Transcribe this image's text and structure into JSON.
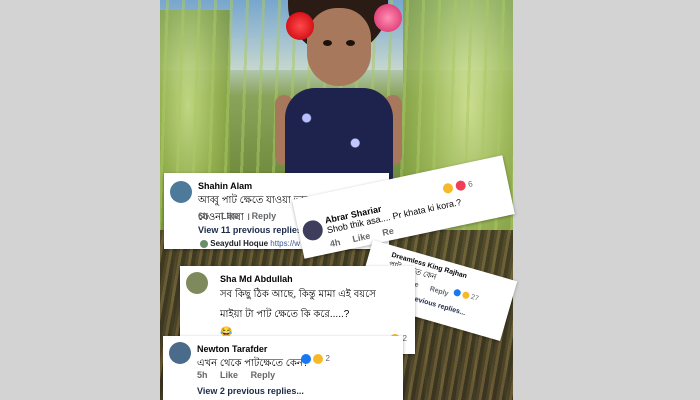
{
  "photo": {
    "description_icons": [
      "red-flower-icon",
      "pink-flower-icon"
    ]
  },
  "comments": {
    "shahin": {
      "name": "Shahin Alam",
      "text": "আব্বু পাট ক্ষেতে যাওয়া ভাল নয় পাট ক্ষেতে যেওনা বাবা ।",
      "time": "6h",
      "like": "Like",
      "reply": "Reply",
      "view_more": "View 11 previous replies...",
      "next_name": "Seaydul Hoque",
      "next_text": "https://w"
    },
    "abrar": {
      "name": "Abrar Shariar",
      "text": "Shob thik asa.... Pr khata ki kora.?",
      "time": "4h",
      "like": "Like",
      "reply": "Re",
      "reaction_count": "6"
    },
    "sha": {
      "name": "Sha Md Abdullah",
      "text_line1": "সব কিছু ঠিক আছে, কিন্তু মামা এই বয়সে",
      "text_line2": "মাইয়া টা পাট ক্ষেতে কি করে.....?",
      "emoji_line": "😂",
      "reaction_count": "2"
    },
    "dreamless": {
      "name": "Dreamless King Rajhan",
      "text": "পাট ক্ষেতে কেন",
      "time": "1d",
      "like": "Like",
      "reply": "Reply",
      "view_more": "View 22 previous replies...",
      "reaction_count": "27"
    },
    "newton": {
      "name": "Newton Tarafder",
      "text": "এখন থেকে পাটক্ষেতে কেন?",
      "time": "5h",
      "like": "Like",
      "reply": "Reply",
      "view_more": "View 2 previous replies...",
      "reaction_count": "2"
    }
  },
  "colors": {
    "background": "#d3d3d3",
    "card": "#ffffff",
    "like_blue": "#1877f2",
    "meta_gray": "#65676b"
  }
}
